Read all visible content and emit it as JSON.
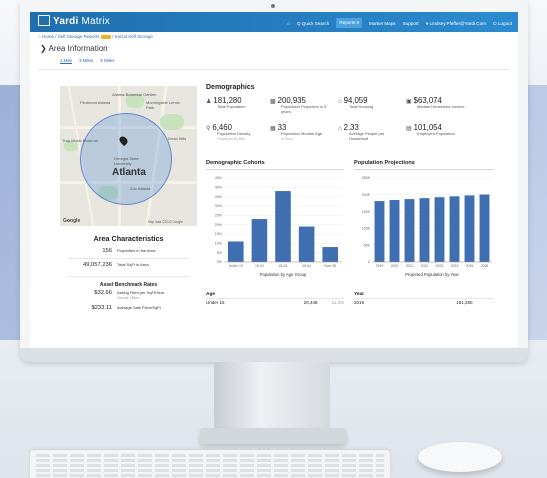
{
  "app": {
    "brand_bold": "Yardi",
    "brand_light": "Matrix"
  },
  "nav": {
    "home_icon": "home-icon",
    "items": [
      {
        "label": "Quick Search"
      },
      {
        "label": "Reports"
      },
      {
        "label": "Market Maps"
      },
      {
        "label": "Support"
      },
      {
        "label": "Lindsey.Pfeffer@Yardi.Com"
      },
      {
        "label": "Logout"
      }
    ],
    "search_icon": "Q"
  },
  "breadcrumb": {
    "home": "Home",
    "reports": "Self Storage Reports",
    "current": "SoCal Self Storage"
  },
  "area": {
    "title": "Area Information",
    "tabs": [
      "1 Mile",
      "3 Miles",
      "5 Miles"
    ]
  },
  "map": {
    "city": "Atlanta",
    "labels": [
      "Atlanta Botanical Garden",
      "Piedmont Atlanta",
      "Morningside Lenox Park",
      "Druid Hills",
      "Trap Music Museum",
      "Zoo Atlanta",
      "Georgia State University"
    ],
    "google": "Google",
    "footer": "Map data ©2022 Google"
  },
  "area_characteristics": {
    "title": "Area Characteristics",
    "stats": [
      {
        "value": "156",
        "label": "Properties in the Area"
      },
      {
        "value": "49,057,236",
        "label": "Total SqFt in Area"
      }
    ],
    "benchmark_title": "Asset Benchmark Rates",
    "benchmarks": [
      {
        "value": "$32.66",
        "label": "Asking Rent per SqFt/Year",
        "sub": "Climate Office"
      },
      {
        "value": "$233.11",
        "label": "Average Sale Price/SqFt",
        "sub": ""
      }
    ]
  },
  "demographics": {
    "title": "Demographics",
    "items": [
      {
        "icon": "people-icon",
        "value": "181,280",
        "label": "Total Population",
        "sub": ""
      },
      {
        "icon": "bar-chart-icon",
        "value": "200,935",
        "label": "Population Projection in 5 years",
        "sub": ""
      },
      {
        "icon": "home-icon",
        "value": "94,059",
        "label": "Total Housing",
        "sub": ""
      },
      {
        "icon": "money-icon",
        "value": "$63,074",
        "label": "Median Household Income",
        "sub": ""
      },
      {
        "icon": "person-icon",
        "value": "6,460",
        "label": "Population Density",
        "sub": "People per Sq Mile"
      },
      {
        "icon": "calendar-icon",
        "value": "33",
        "label": "Population Median Age",
        "sub": "In Years"
      },
      {
        "icon": "house-icon",
        "value": "2.33",
        "label": "Average People per Household",
        "sub": ""
      },
      {
        "icon": "briefcase-icon",
        "value": "101,054",
        "label": "Employed Population",
        "sub": ""
      }
    ]
  },
  "cohort_table": {
    "header": "Age",
    "rows": [
      {
        "c1": "Under 15",
        "c2": "20,448",
        "c3": "11.3%"
      }
    ]
  },
  "projection_table": {
    "header": "Year",
    "rows": [
      {
        "c1": "2019",
        "c2": "181,280",
        "c3": "-"
      }
    ]
  },
  "chart_data": [
    {
      "type": "bar",
      "title": "Demographic Cohorts",
      "categories": [
        "Under 15",
        "15-24",
        "25-44",
        "45-64",
        "Over 65"
      ],
      "values": [
        11,
        23,
        38,
        19,
        8
      ],
      "value_unit": "%",
      "yticks": [
        "0%",
        "5%",
        "10%",
        "15%",
        "20%",
        "25%",
        "30%",
        "35%",
        "40%",
        "45%"
      ],
      "ylim": [
        0,
        45
      ],
      "xlabel": "Population by Age Group",
      "ylabel": "",
      "color": "#3f6fb0"
    },
    {
      "type": "bar",
      "title": "Population Projections",
      "categories": [
        "2019",
        "2020",
        "2021",
        "2022",
        "2023",
        "2024",
        "2025",
        "2026"
      ],
      "values": [
        181280,
        184500,
        187200,
        190000,
        192800,
        195500,
        198200,
        200935
      ],
      "yticks": [
        "0",
        "50K",
        "100K",
        "150K",
        "200K",
        "250K"
      ],
      "ylim": [
        0,
        250000
      ],
      "xlabel": "Projected Population by Year",
      "ylabel": "",
      "color": "#3f6fb0"
    }
  ]
}
